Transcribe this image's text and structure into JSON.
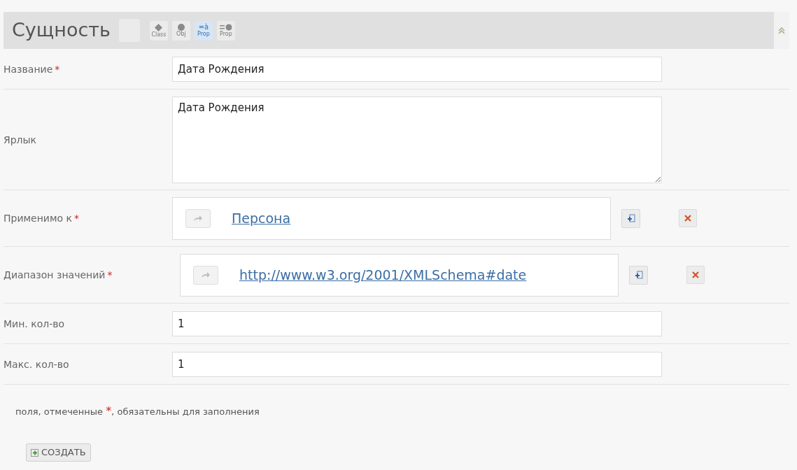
{
  "header": {
    "title": "Сущность",
    "tools": [
      {
        "kind": "blank",
        "selected": false
      },
      {
        "kind": "diamond",
        "label": "Class",
        "selected": false
      },
      {
        "kind": "circle",
        "label": "Obj",
        "selected": false
      },
      {
        "kind": "letter",
        "glyph": "=à",
        "label": "Prop",
        "selected": true
      },
      {
        "kind": "eqcircle",
        "label": "Prop",
        "selected": false
      }
    ]
  },
  "fields": [
    {
      "kind": "text",
      "label": "Название",
      "required_mark": "*",
      "value": "Дата Рождения"
    },
    {
      "kind": "textarea",
      "label": "Ярлык",
      "value": "Дата Рождения"
    },
    {
      "kind": "reference",
      "label": "Применимо к",
      "required_mark": "*",
      "link": "Персона"
    },
    {
      "kind": "reference",
      "label": "Диапазон значений",
      "required_mark": "*",
      "link": "http://www.w3.org/2001/XMLSchema#date"
    },
    {
      "kind": "text",
      "label": "Мин. кол-во",
      "value": "1"
    },
    {
      "kind": "text",
      "label": "Макс. кол-во",
      "value": "1"
    }
  ],
  "note": [
    "поля, отмеченные ",
    "*",
    ", обязательны для заполнения"
  ],
  "create_button": "СОЗДАТЬ"
}
